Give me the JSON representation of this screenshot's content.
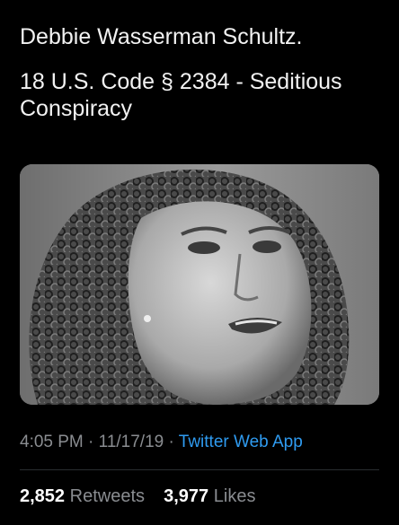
{
  "tweet": {
    "text_line_1": "Debbie Wasserman Schultz.",
    "text_line_2": "18 U.S. Code § 2384 - Seditious Conspiracy",
    "photo_icon": "portrait-photo",
    "time": "4:05 PM",
    "date": "11/17/19",
    "separator": "·",
    "source": "Twitter Web App",
    "retweets_count": "2,852",
    "retweets_label": "Retweets",
    "likes_count": "3,977",
    "likes_label": "Likes"
  },
  "colors": {
    "background": "#000000",
    "text": "#f2f2f2",
    "meta": "#8a8d91",
    "link": "#2f9bf0"
  }
}
